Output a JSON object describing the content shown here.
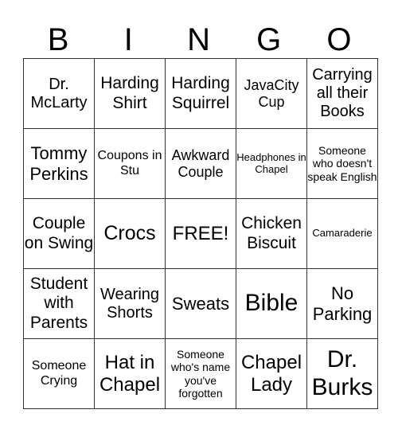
{
  "header": {
    "letters": [
      "B",
      "I",
      "N",
      "G",
      "O"
    ]
  },
  "board": {
    "rows": [
      [
        "Dr. McLarty",
        "Harding Shirt",
        "Harding Squirrel",
        "JavaCity Cup",
        "Carrying all their Books"
      ],
      [
        "Tommy Perkins",
        "Coupons in Stu",
        "Awkward Couple",
        "Headphones in Chapel",
        "Someone who doesn't speak English"
      ],
      [
        "Couple on Swing",
        "Crocs",
        "FREE!",
        "Chicken Biscuit",
        "Camaraderie"
      ],
      [
        "Student with Parents",
        "Wearing Shorts",
        "Sweats",
        "Bible",
        "No Parking"
      ],
      [
        "Someone Crying",
        "Hat in Chapel",
        "Someone who's name you've forgotten",
        "Chapel Lady",
        "Dr. Burks"
      ]
    ]
  }
}
